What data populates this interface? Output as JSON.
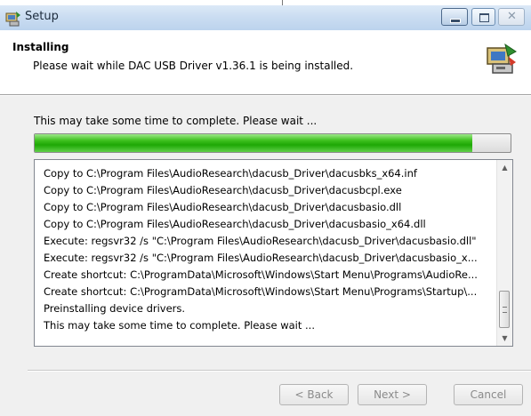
{
  "window": {
    "title": "Setup",
    "controls": [
      "minimize",
      "maximize",
      "close"
    ]
  },
  "header": {
    "title": "Installing",
    "subtitle": "Please wait while DAC USB Driver v1.36.1 is being installed.",
    "icon": "installer-icon"
  },
  "status_text": "This may take some time to complete. Please wait ...",
  "progress": {
    "fraction": 0.92,
    "color": "#2fb814"
  },
  "log": {
    "lines": [
      "Copy to C:\\Program Files\\AudioResearch\\dacusb_Driver\\dacusbks_x64.inf",
      "Copy to C:\\Program Files\\AudioResearch\\dacusb_Driver\\dacusbcpl.exe",
      "Copy to C:\\Program Files\\AudioResearch\\dacusb_Driver\\dacusbasio.dll",
      "Copy to C:\\Program Files\\AudioResearch\\dacusb_Driver\\dacusbasio_x64.dll",
      "Execute: regsvr32 /s \"C:\\Program Files\\AudioResearch\\dacusb_Driver\\dacusbasio.dll\"",
      "Execute: regsvr32 /s \"C:\\Program Files\\AudioResearch\\dacusb_Driver\\dacusbasio_x...",
      "Create shortcut: C:\\ProgramData\\Microsoft\\Windows\\Start Menu\\Programs\\AudioRe...",
      "Create shortcut: C:\\ProgramData\\Microsoft\\Windows\\Start Menu\\Programs\\Startup\\...",
      "Preinstalling device drivers.",
      "This may take some time to complete. Please wait ..."
    ]
  },
  "buttons": {
    "back": "< Back",
    "next": "Next >",
    "cancel": "Cancel"
  }
}
